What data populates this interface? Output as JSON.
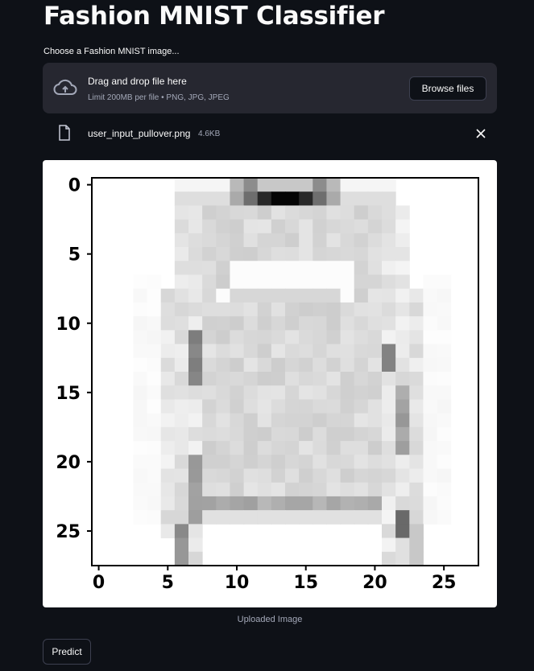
{
  "page": {
    "title": "Fashion MNIST Classifier"
  },
  "uploader": {
    "label": "Choose a Fashion MNIST image...",
    "drop_text": "Drag and drop file here",
    "limit_text": "Limit 200MB per file • PNG, JPG, JPEG",
    "browse_label": "Browse files",
    "icons": {
      "upload": "cloud-upload-icon",
      "file": "file-icon",
      "remove": "close-icon"
    }
  },
  "file": {
    "name": "user_input_pullover.png",
    "size": "4.6KB"
  },
  "image": {
    "caption": "Uploaded Image",
    "x_ticks": [
      "0",
      "5",
      "10",
      "15",
      "20",
      "25"
    ],
    "y_ticks": [
      "0",
      "5",
      "10",
      "15",
      "20",
      "25"
    ]
  },
  "actions": {
    "predict_label": "Predict"
  }
}
